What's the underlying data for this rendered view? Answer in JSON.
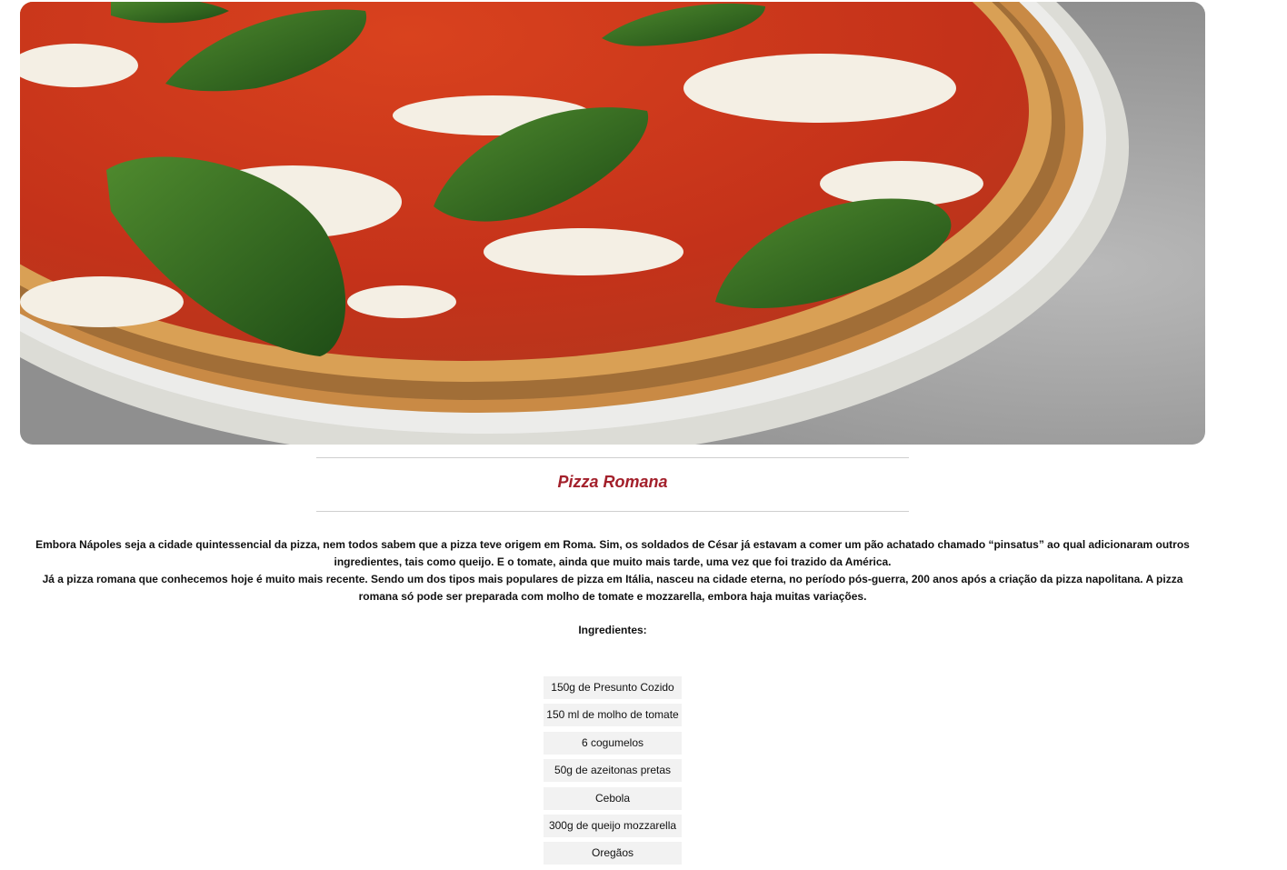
{
  "hero_image": {
    "description_icon": "pizza-photo"
  },
  "recipe": {
    "title": "Pizza Romana",
    "description": [
      "Embora Nápoles seja a cidade quintessencial da pizza, nem todos sabem que a pizza teve origem em Roma. Sim, os soldados de César já estavam a comer um pão achatado chamado “pinsatus” ao qual adicionaram outros ingredientes, tais como queijo. E o tomate, ainda que muito mais tarde, uma vez que foi trazido da América.",
      "Já a pizza romana que conhecemos hoje é muito mais recente. Sendo um dos tipos mais populares de pizza em Itália, nasceu na cidade eterna, no período pós-guerra, 200 anos após a criação da pizza napolitana. A pizza romana só pode ser preparada com molho de tomate e mozzarella, embora haja muitas variações."
    ],
    "ingredients_heading": "Ingredientes:",
    "ingredients": [
      "150g de Presunto Cozido",
      "150 ml de molho de tomate",
      "6 cogumelos",
      "50g de azeitonas pretas",
      "Cebola",
      "300g de queijo mozzarella",
      "Oregãos"
    ]
  },
  "colors": {
    "title": "#a3202b",
    "ingredient_bg": "#f2f2f2"
  }
}
